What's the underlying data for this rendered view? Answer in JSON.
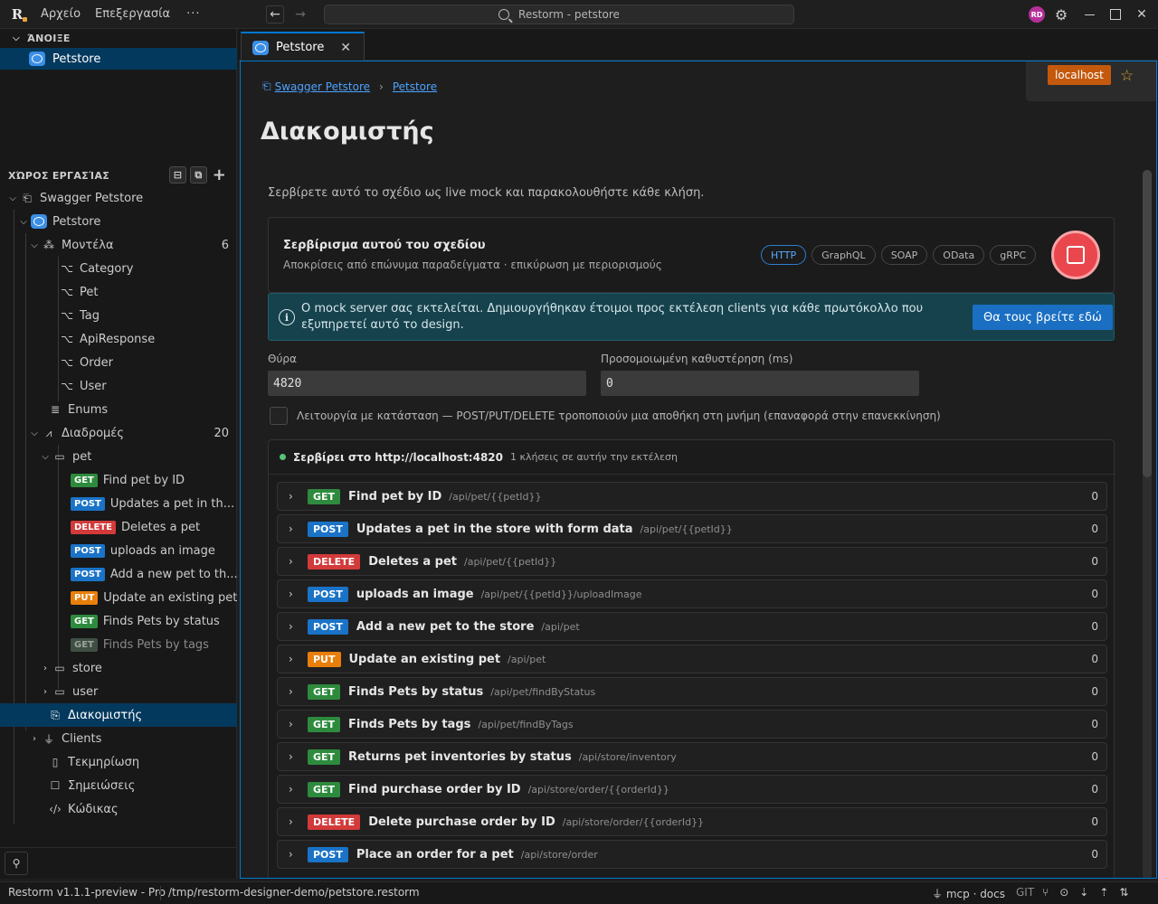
{
  "titlebar": {
    "menu": [
      "Αρχείο",
      "Επεξεργασία"
    ],
    "more": "···",
    "search": "Restorm - petstore",
    "avatar": "RD"
  },
  "sidebar": {
    "open_header": "ΆΝΟΙΞΕ",
    "open_item": "Petstore",
    "workspace_header": "ΧΏΡΟΣ ΕΡΓΑΣΊΑΣ",
    "tree": {
      "root": "Swagger Petstore",
      "api": "Petstore",
      "models_label": "Μοντέλα",
      "models_count": "6",
      "models": [
        "Category",
        "Pet",
        "Tag",
        "ApiResponse",
        "Order",
        "User"
      ],
      "enums": "Enums",
      "routes_label": "Διαδρομές",
      "routes_count": "20",
      "pet_folder": "pet",
      "pet_routes": [
        {
          "method": "GET",
          "label": "Find pet by ID"
        },
        {
          "method": "POST",
          "label": "Updates a pet in th..."
        },
        {
          "method": "DELETE",
          "label": "Deletes a pet"
        },
        {
          "method": "POST",
          "label": "uploads an image"
        },
        {
          "method": "POST",
          "label": "Add a new pet to th..."
        },
        {
          "method": "PUT",
          "label": "Update an existing pet"
        },
        {
          "method": "GET",
          "label": "Finds Pets by status"
        },
        {
          "method": "GET",
          "label": "Finds Pets by tags"
        }
      ],
      "store_folder": "store",
      "user_folder": "user",
      "server": "Διακομιστής",
      "clients": "Clients",
      "docs": "Τεκμηρίωση",
      "notes": "Σημειώσεις",
      "code": "Κώδικας"
    }
  },
  "tab": {
    "label": "Petstore"
  },
  "environment": "localhost",
  "breadcrumb": [
    "Swagger Petstore",
    "Petstore"
  ],
  "page": {
    "title": "Διακομιστής",
    "lead": "Σερβίρετε αυτό το σχέδιο ως live mock και παρακολουθήστε κάθε κλήση.",
    "serve_title": "Σερβίρισμα αυτού του σχεδίου",
    "serve_sub": "Αποκρίσεις από επώνυμα παραδείγματα · επικύρωση με περιορισμούς",
    "protocols": [
      "HTTP",
      "GraphQL",
      "SOAP",
      "OData",
      "gRPC"
    ],
    "active_protocol": "HTTP",
    "info": "Ο mock server σας εκτελείται. Δημιουργήθηκαν έτοιμοι προς εκτέλεση clients για κάθε πρωτόκολλο που εξυπηρετεί αυτό το design.",
    "info_button": "Θα τους βρείτε εδώ",
    "port_label": "Θύρα",
    "port_value": "4820",
    "latency_label": "Προσομοιωμένη καθυστέρηση (ms)",
    "latency_value": "0",
    "stateful_label": "Λειτουργία με κατάσταση — POST/PUT/DELETE τροποποιούν μια αποθήκη στη μνήμη (επαναφορά στην επανεκκίνηση)",
    "serving_text": "Σερβίρει στο http://localhost:4820",
    "calls_text": "1 κλήσεις σε αυτήν την εκτέλεση"
  },
  "endpoints": [
    {
      "method": "GET",
      "summary": "Find pet by ID",
      "path": "/api/pet/{{petId}}",
      "hits": "0"
    },
    {
      "method": "POST",
      "summary": "Updates a pet in the store with form data",
      "path": "/api/pet/{{petId}}",
      "hits": "0"
    },
    {
      "method": "DELETE",
      "summary": "Deletes a pet",
      "path": "/api/pet/{{petId}}",
      "hits": "0"
    },
    {
      "method": "POST",
      "summary": "uploads an image",
      "path": "/api/pet/{{petId}}/uploadImage",
      "hits": "0"
    },
    {
      "method": "POST",
      "summary": "Add a new pet to the store",
      "path": "/api/pet",
      "hits": "0"
    },
    {
      "method": "PUT",
      "summary": "Update an existing pet",
      "path": "/api/pet",
      "hits": "0"
    },
    {
      "method": "GET",
      "summary": "Finds Pets by status",
      "path": "/api/pet/findByStatus",
      "hits": "0"
    },
    {
      "method": "GET",
      "summary": "Finds Pets by tags",
      "path": "/api/pet/findByTags",
      "hits": "0"
    },
    {
      "method": "GET",
      "summary": "Returns pet inventories by status",
      "path": "/api/store/inventory",
      "hits": "0"
    },
    {
      "method": "GET",
      "summary": "Find purchase order by ID",
      "path": "/api/store/order/{{orderId}}",
      "hits": "0"
    },
    {
      "method": "DELETE",
      "summary": "Delete purchase order by ID",
      "path": "/api/store/order/{{orderId}}",
      "hits": "0"
    },
    {
      "method": "POST",
      "summary": "Place an order for a pet",
      "path": "/api/store/order",
      "hits": "0"
    }
  ],
  "method_colors": {
    "GET": "#2e8b3e",
    "POST": "#1a73c7",
    "DELETE": "#d33a3a",
    "PUT": "#e87f0b"
  },
  "statusbar": {
    "version": "Restorm v1.1.1-preview - Pro",
    "path": "/tmp/restorm-designer-demo/petstore.restorm",
    "mcp": "mcp · docs",
    "git": "GIT"
  }
}
